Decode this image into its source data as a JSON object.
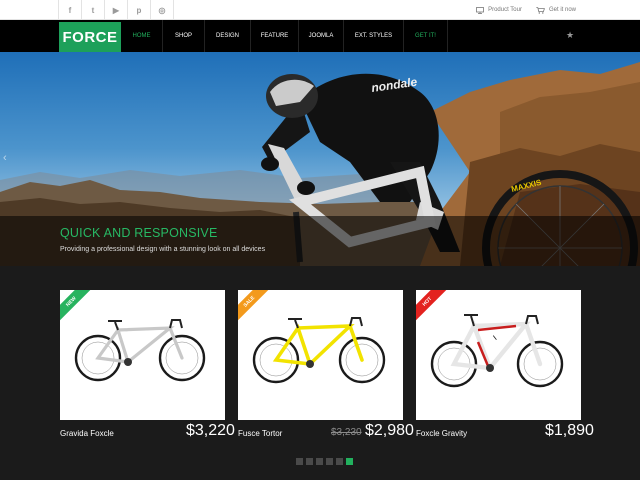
{
  "topbar": {
    "social": [
      {
        "icon": "facebook-icon",
        "glyph": "f"
      },
      {
        "icon": "twitter-icon",
        "glyph": "t"
      },
      {
        "icon": "youtube-icon",
        "glyph": "▶"
      },
      {
        "icon": "pinterest-icon",
        "glyph": "p"
      },
      {
        "icon": "dribbble-icon",
        "glyph": "◎"
      }
    ],
    "product_tour": "Product Tour",
    "get_it_now": "Get it now"
  },
  "nav": {
    "logo": "FORCE",
    "items": [
      {
        "label": "Home",
        "active": true
      },
      {
        "label": "Shop"
      },
      {
        "label": "Design"
      },
      {
        "label": "Feature"
      },
      {
        "label": "Joomla"
      },
      {
        "label": "Ext. Styles"
      },
      {
        "label": "Get it!",
        "highlight": true
      }
    ],
    "star": "★"
  },
  "hero": {
    "title": "QUICK AND RESPONSIVE",
    "subtitle": "Providing a professional design with a stunning look on all devices",
    "jersey_text": "nondale",
    "tire_text": "MAXXIS",
    "prev_arrow": "‹"
  },
  "products": [
    {
      "name": "Gravida Foxcle",
      "badge": "NEW",
      "badge_color": "#27b35f",
      "price": "$3,220",
      "frame_color": "#c8c8c8"
    },
    {
      "name": "Fusce Tortor",
      "badge": "SALE",
      "badge_color": "#f39a1c",
      "old_price": "$3,230",
      "price": "$2,980",
      "frame_color": "#f2e300"
    },
    {
      "name": "Foxcle Gravity",
      "badge": "HOT",
      "badge_color": "#e3221f",
      "price": "$1,890",
      "frame_color": "#f4f4f4"
    }
  ],
  "colors": {
    "accent": "#22b15e",
    "nav_bg": "#000000",
    "body_bg": "#1b1b1b"
  },
  "carousel": {
    "page_count": 6,
    "active_index": 5
  }
}
